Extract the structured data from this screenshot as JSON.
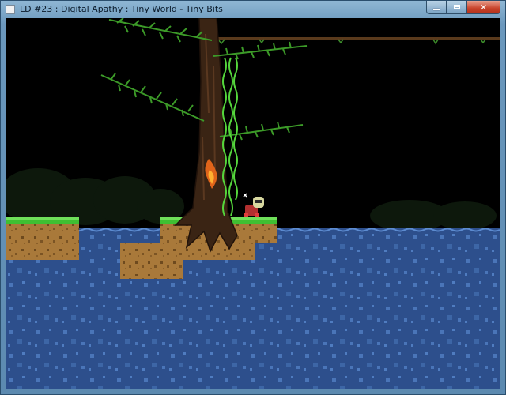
{
  "window": {
    "title": "LD #23 : Digital Apathy : Tiny World - Tiny Bits",
    "icon": "app-window-icon",
    "controls": {
      "minimize": "minimize-icon",
      "maximize": "maximize-icon",
      "close": "close-icon"
    }
  },
  "game": {
    "colors": {
      "sky": "#000000",
      "water": "#2d4f8c",
      "grass": "#3fbf32",
      "dirt": "#a9793a",
      "trunk": "#3a2414",
      "leaves": "#3c9a28",
      "vine": "#55d63c",
      "flame": "#e0641a"
    },
    "entities": [
      "tree",
      "hanging-vines",
      "burning-fire",
      "player-character",
      "floating-island-left",
      "floating-island-center",
      "rope-bridge"
    ]
  }
}
